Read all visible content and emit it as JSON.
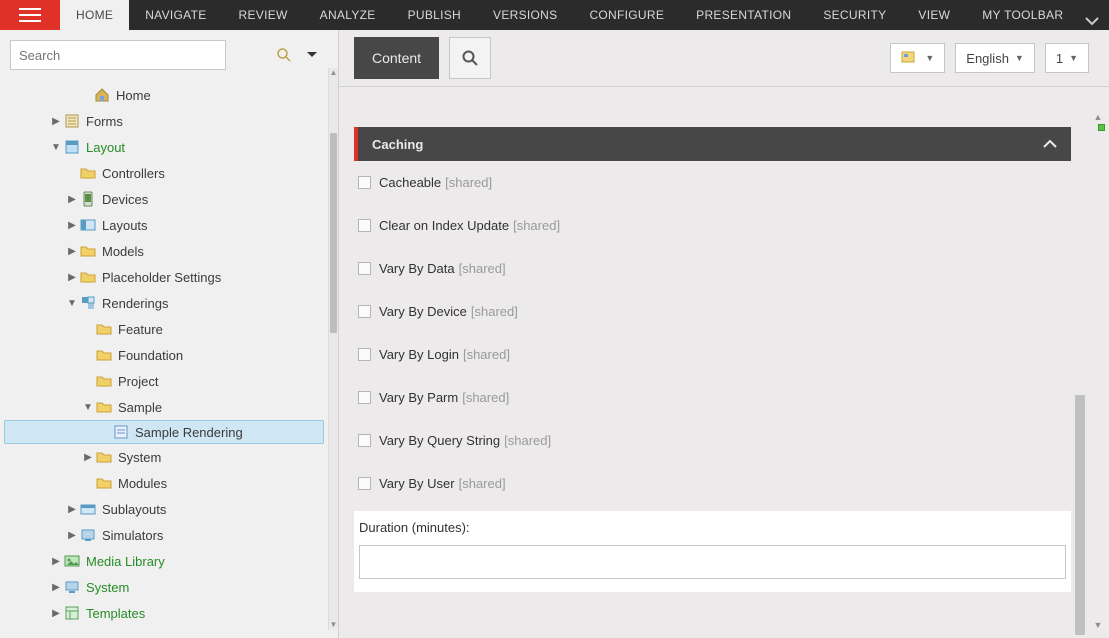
{
  "ribbon": {
    "tabs": [
      "HOME",
      "NAVIGATE",
      "REVIEW",
      "ANALYZE",
      "PUBLISH",
      "VERSIONS",
      "CONFIGURE",
      "PRESENTATION",
      "SECURITY",
      "VIEW",
      "MY TOOLBAR"
    ],
    "active": 0
  },
  "search": {
    "placeholder": "Search"
  },
  "tree": [
    {
      "indent": 0,
      "exp": "",
      "icon": "home-icon",
      "label": "Home",
      "class": ""
    },
    {
      "indent": 1,
      "exp": "▶",
      "icon": "form-icon",
      "label": "Forms",
      "class": ""
    },
    {
      "indent": 1,
      "exp": "▼",
      "icon": "layout-icon",
      "label": "Layout",
      "class": "green"
    },
    {
      "indent": 2,
      "exp": "",
      "icon": "folder-icon",
      "label": "Controllers",
      "class": ""
    },
    {
      "indent": 2,
      "exp": "▶",
      "icon": "device-icon",
      "label": "Devices",
      "class": ""
    },
    {
      "indent": 2,
      "exp": "▶",
      "icon": "layouts-icon",
      "label": "Layouts",
      "class": ""
    },
    {
      "indent": 2,
      "exp": "▶",
      "icon": "folder-icon",
      "label": "Models",
      "class": ""
    },
    {
      "indent": 2,
      "exp": "▶",
      "icon": "folder-icon",
      "label": "Placeholder Settings",
      "class": ""
    },
    {
      "indent": 2,
      "exp": "▼",
      "icon": "render-icon",
      "label": "Renderings",
      "class": ""
    },
    {
      "indent": 3,
      "exp": "",
      "icon": "folder-icon",
      "label": "Feature",
      "class": ""
    },
    {
      "indent": 3,
      "exp": "",
      "icon": "folder-icon",
      "label": "Foundation",
      "class": ""
    },
    {
      "indent": 3,
      "exp": "",
      "icon": "folder-icon",
      "label": "Project",
      "class": ""
    },
    {
      "indent": 3,
      "exp": "▼",
      "icon": "folder-icon",
      "label": "Sample",
      "class": ""
    },
    {
      "indent": 4,
      "exp": "",
      "icon": "rend-icon",
      "label": "Sample Rendering",
      "class": "sel"
    },
    {
      "indent": 3,
      "exp": "▶",
      "icon": "folder-icon",
      "label": "System",
      "class": ""
    },
    {
      "indent": 3,
      "exp": "",
      "icon": "folder-icon",
      "label": "Modules",
      "class": ""
    },
    {
      "indent": 2,
      "exp": "▶",
      "icon": "sublay-icon",
      "label": "Sublayouts",
      "class": ""
    },
    {
      "indent": 2,
      "exp": "▶",
      "icon": "sim-icon",
      "label": "Simulators",
      "class": ""
    },
    {
      "indent": 1,
      "exp": "▶",
      "icon": "media-icon",
      "label": "Media Library",
      "class": "green"
    },
    {
      "indent": 1,
      "exp": "▶",
      "icon": "system-icon",
      "label": "System",
      "class": "green"
    },
    {
      "indent": 1,
      "exp": "▶",
      "icon": "template-icon",
      "label": "Templates",
      "class": "green"
    }
  ],
  "content_toolbar": {
    "tab": "Content",
    "language": "English",
    "version": "1"
  },
  "section": {
    "title": "Caching",
    "shared_hint": "[shared]",
    "fields": [
      {
        "label": "Cacheable"
      },
      {
        "label": "Clear on Index Update"
      },
      {
        "label": "Vary By Data"
      },
      {
        "label": "Vary By Device"
      },
      {
        "label": "Vary By Login"
      },
      {
        "label": "Vary By Parm"
      },
      {
        "label": "Vary By Query String"
      },
      {
        "label": "Vary By User"
      }
    ],
    "duration_label": "Duration (minutes):",
    "duration_value": ""
  }
}
